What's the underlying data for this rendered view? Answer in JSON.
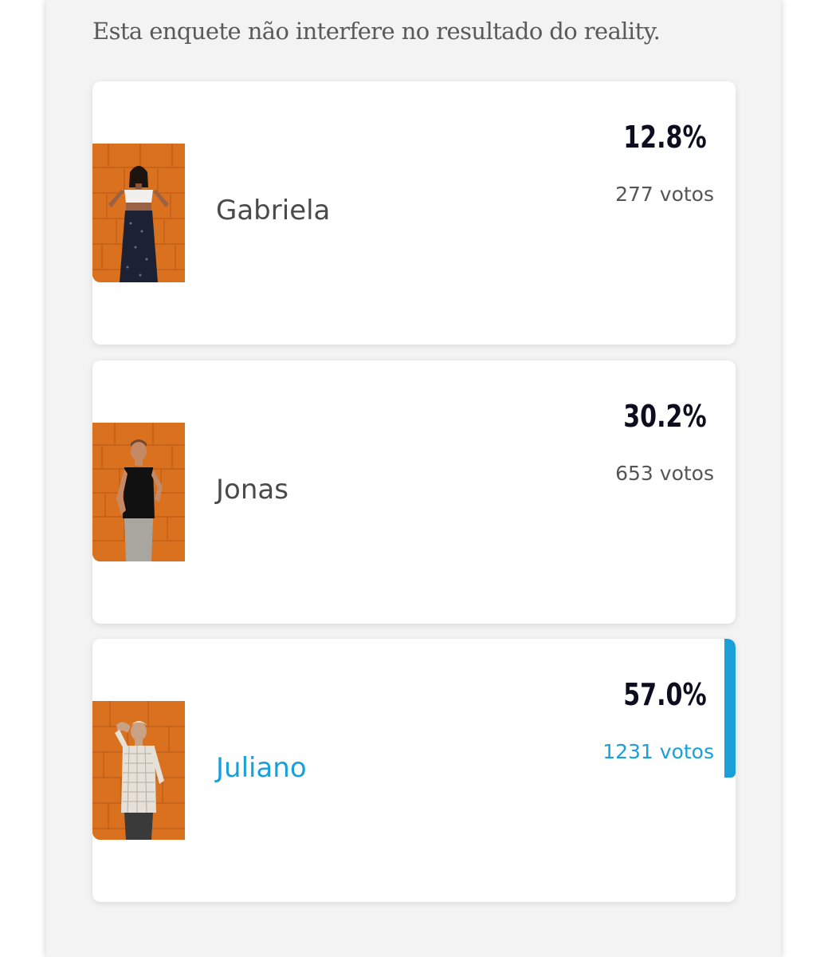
{
  "poll": {
    "disclaimer": "Esta enquete não interfere no resultado do reality.",
    "accent_color": "#1aa0d8",
    "candidates": [
      {
        "name": "Gabriela",
        "percent": "12.8%",
        "votes": "277 votos",
        "leading": false
      },
      {
        "name": "Jonas",
        "percent": "30.2%",
        "votes": "653 votos",
        "leading": false
      },
      {
        "name": "Juliano",
        "percent": "57.0%",
        "votes": "1231 votos",
        "leading": true
      }
    ]
  }
}
